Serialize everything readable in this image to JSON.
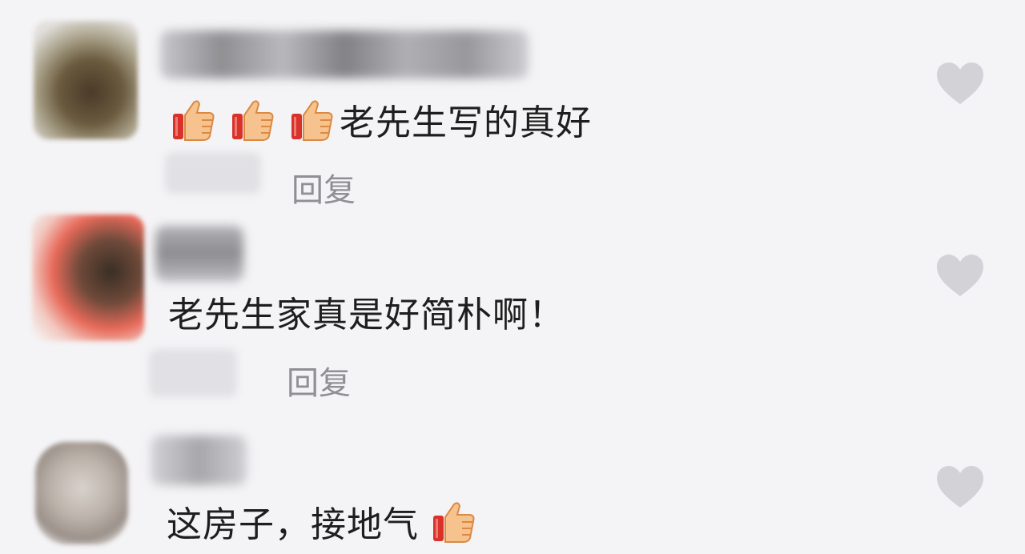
{
  "colors": {
    "background": "#f4f3f5",
    "text": "#1e1e1e",
    "reply": "#8f8f96",
    "heart": "#d3d3d7",
    "thumb_fill": "#f6c38e",
    "thumb_sleeve": "#d8322a"
  },
  "comments": [
    {
      "emoji_prefix": [
        "thumbs-up",
        "thumbs-up",
        "thumbs-up"
      ],
      "text": "老先生写的真好",
      "reply_label": "回复",
      "like_icon": "heart-icon"
    },
    {
      "emoji_prefix": [],
      "text": "老先生家真是好简朴啊！",
      "reply_label": "回复",
      "like_icon": "heart-icon"
    },
    {
      "emoji_prefix": [],
      "text": "这房子，接地气",
      "emoji_suffix": [
        "thumbs-up"
      ],
      "like_icon": "heart-icon"
    }
  ]
}
